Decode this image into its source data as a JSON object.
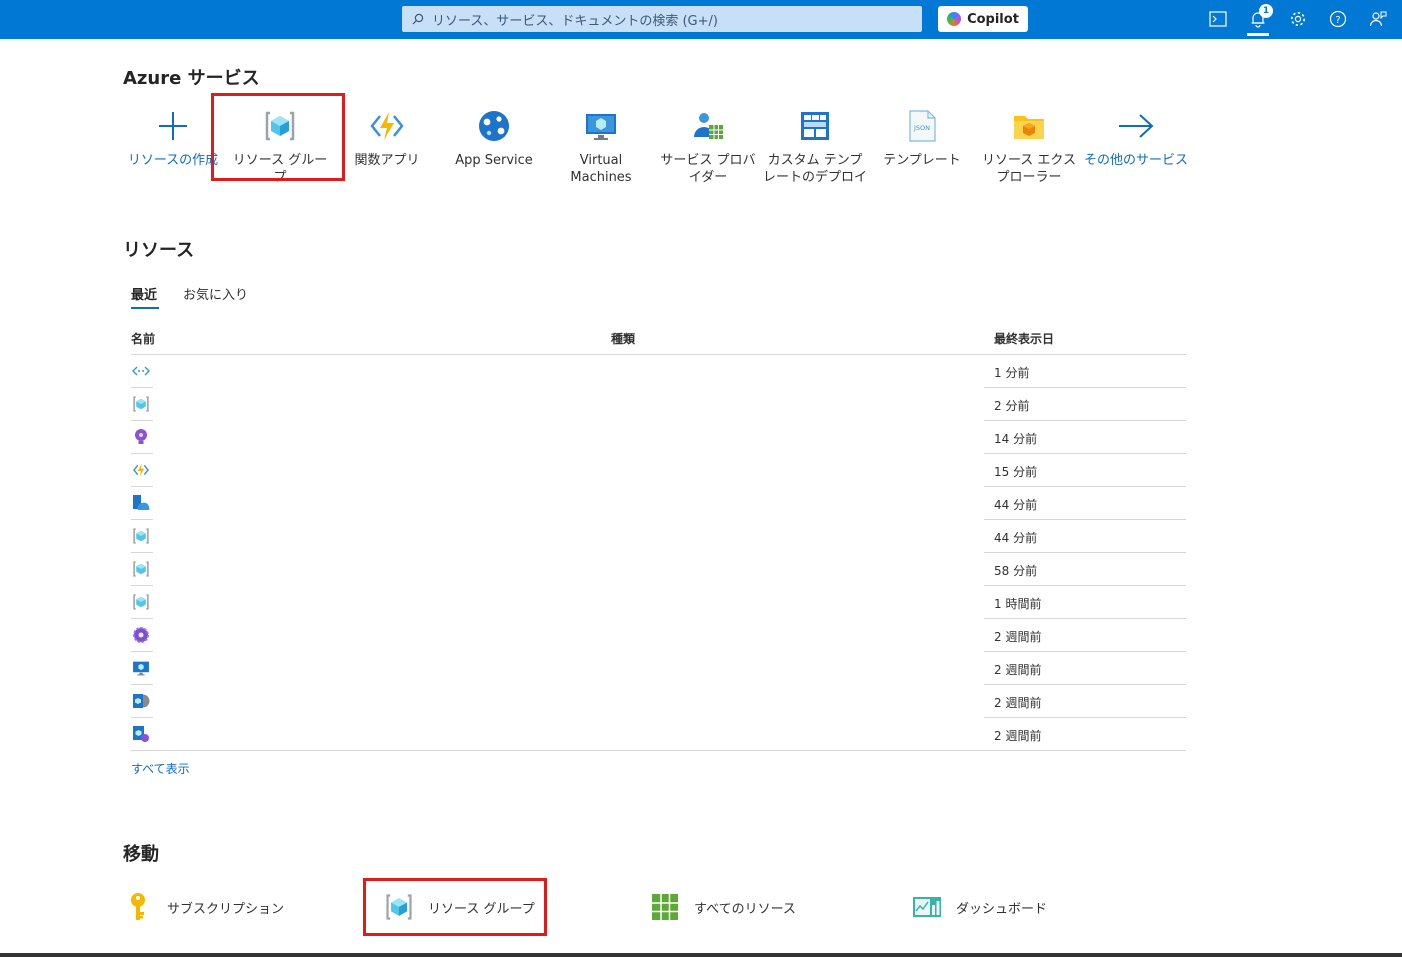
{
  "topbar": {
    "search_placeholder": "リソース、サービス、ドキュメントの検索 (G+/)",
    "copilot_label": "Copilot",
    "notification_count": "1",
    "icons": [
      "cloud-shell-icon",
      "notification-bell-icon",
      "settings-gear-icon",
      "help-icon",
      "feedback-icon"
    ]
  },
  "services": {
    "title": "Azure サービス",
    "items": [
      {
        "label": "リソースの作成",
        "icon": "plus-icon"
      },
      {
        "label": "リソース グループ",
        "icon": "resource-group-icon"
      },
      {
        "label": "関数アプリ",
        "icon": "function-app-icon"
      },
      {
        "label": "App Service",
        "icon": "app-service-icon"
      },
      {
        "label": "Virtual Machines",
        "icon": "virtual-machine-icon"
      },
      {
        "label": "サービス プロバイダー",
        "icon": "service-provider-icon"
      },
      {
        "label": "カスタム テンプレートのデプロイ",
        "icon": "template-deploy-icon"
      },
      {
        "label": "テンプレート",
        "icon": "json-template-icon"
      },
      {
        "label": "リソース エクスプローラー",
        "icon": "resource-explorer-icon"
      },
      {
        "label": "その他のサービス",
        "icon": "arrow-right-icon"
      }
    ]
  },
  "resources": {
    "title": "リソース",
    "tabs": [
      "最近",
      "お気に入り"
    ],
    "columns": [
      "名前",
      "種類",
      "最終表示日"
    ],
    "rows": [
      {
        "icon": "private-endpoint-icon",
        "last_viewed": "1 分前"
      },
      {
        "icon": "resource-group-icon",
        "last_viewed": "2 分前"
      },
      {
        "icon": "application-insights-icon",
        "last_viewed": "14 分前"
      },
      {
        "icon": "function-app-icon",
        "last_viewed": "15 分前"
      },
      {
        "icon": "app-service-plan-icon",
        "last_viewed": "44 分前"
      },
      {
        "icon": "resource-group-icon",
        "last_viewed": "44 分前"
      },
      {
        "icon": "resource-group-icon",
        "last_viewed": "58 分前"
      },
      {
        "icon": "resource-group-icon",
        "last_viewed": "1 時間前"
      },
      {
        "icon": "gear-service-icon",
        "last_viewed": "2 週間前"
      },
      {
        "icon": "virtual-machine-icon",
        "last_viewed": "2 週間前"
      },
      {
        "icon": "sql-server-icon",
        "last_viewed": "2 週間前"
      },
      {
        "icon": "sql-database-icon",
        "last_viewed": "2 週間前"
      }
    ],
    "show_all": "すべて表示"
  },
  "navigate": {
    "title": "移動",
    "items": [
      {
        "label": "サブスクリプション",
        "icon": "key-icon"
      },
      {
        "label": "リソース グループ",
        "icon": "resource-group-icon"
      },
      {
        "label": "すべてのリソース",
        "icon": "grid-icon"
      },
      {
        "label": "ダッシュボード",
        "icon": "dashboard-icon"
      }
    ]
  },
  "colors": {
    "topbar": "#0078d4",
    "link": "#0f6cbd",
    "highlight": "#e01b1b"
  }
}
